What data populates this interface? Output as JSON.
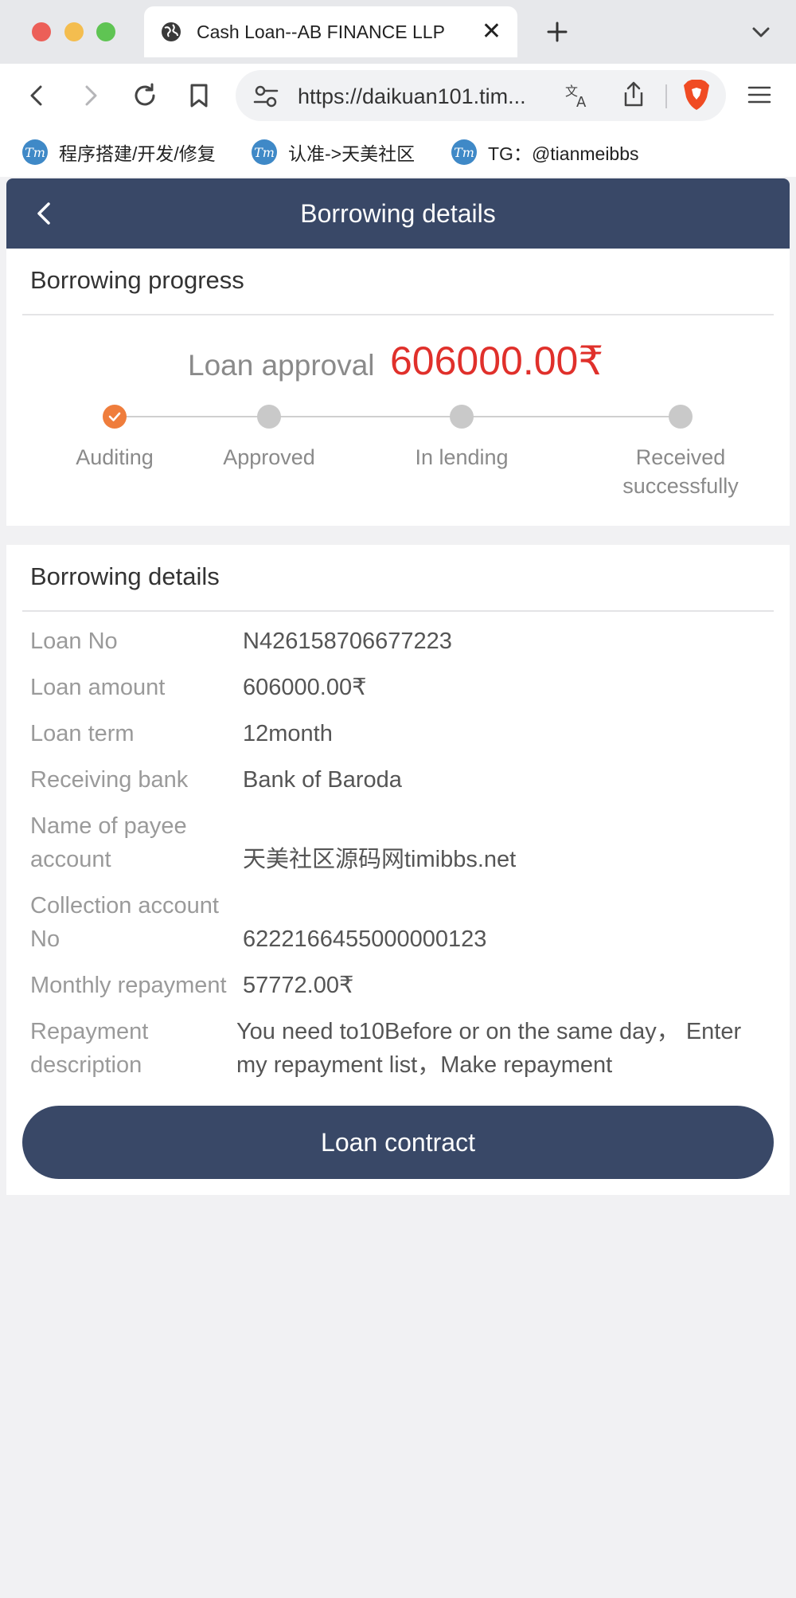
{
  "browser": {
    "tab_title": "Cash Loan--AB FINANCE LLP",
    "tab_close": "✕",
    "new_tab": "+",
    "url": "https://daikuan101.tim...",
    "bookmarks": [
      {
        "label": "程序搭建/开发/修复"
      },
      {
        "label": "认准->天美社区"
      },
      {
        "label": "TG：@tianmeibbs"
      }
    ],
    "bookmark_icon_text": "Tm"
  },
  "header": {
    "title": "Borrowing details"
  },
  "progress": {
    "title": "Borrowing progress",
    "approval_label": "Loan approval",
    "approval_amount": "606000.00₹",
    "steps": [
      {
        "label": "Auditing",
        "done": true
      },
      {
        "label": "Approved",
        "done": false
      },
      {
        "label": "In lending",
        "done": false
      },
      {
        "label": "Received successfully",
        "done": false
      }
    ],
    "steps_display": {
      "received_line1": "Received",
      "received_line2": "successfully"
    }
  },
  "details": {
    "title": "Borrowing details",
    "rows": [
      {
        "label": "Loan No",
        "value": "N426158706677223"
      },
      {
        "label": "Loan amount",
        "value": "606000.00₹"
      },
      {
        "label": "Loan term",
        "value": "12month"
      },
      {
        "label": "Receiving bank",
        "value": "Bank of Baroda"
      },
      {
        "label_line1": "Name of payee",
        "label_line2": "account",
        "value": "天美社区源码网timibbs.net"
      },
      {
        "label_line1": "Collection account",
        "label_line2": "No",
        "value": "6222166455000000123"
      },
      {
        "label": "Monthly repayment",
        "value": "57772.00₹"
      },
      {
        "label_line1": "Repayment",
        "label_line2": "description",
        "value_line1": "You need to10Before or on the same day，  Enter",
        "value_line2": "my repayment list，Make repayment"
      }
    ]
  },
  "actions": {
    "contract_button": "Loan contract"
  },
  "colors": {
    "primary": "#394867",
    "amount_red": "#e0302b",
    "step_done": "#ef7d3c",
    "step_pending": "#c9c9c9"
  }
}
